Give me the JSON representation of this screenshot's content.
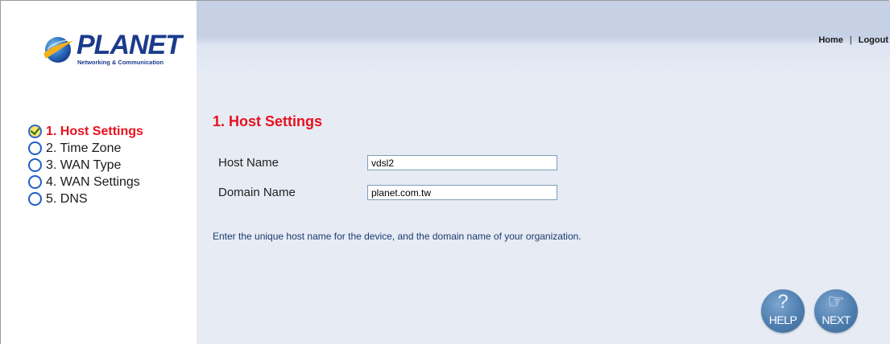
{
  "brand": {
    "name": "PLANET",
    "tagline": "Networking & Communication",
    "colors": {
      "primary": "#1b3b8c",
      "accent": "#e6111d"
    }
  },
  "steps": [
    {
      "label": "1. Host Settings",
      "active": true
    },
    {
      "label": "2. Time Zone",
      "active": false
    },
    {
      "label": "3. WAN Type",
      "active": false
    },
    {
      "label": "4. WAN Settings",
      "active": false
    },
    {
      "label": "5. DNS",
      "active": false
    }
  ],
  "topnav": {
    "home": "Home",
    "separator": "|",
    "logout": "Logout"
  },
  "page": {
    "title": "1. Host Settings",
    "host_name_label": "Host Name",
    "host_name_value": "vdsl2",
    "domain_name_label": "Domain Name",
    "domain_name_value": "planet.com.tw",
    "hint": "Enter the unique host name for the device, and the domain name of your organization."
  },
  "buttons": {
    "help": "HELP",
    "next": "NEXT",
    "help_icon": "question-mark-icon",
    "next_icon": "pointing-hand-icon"
  }
}
